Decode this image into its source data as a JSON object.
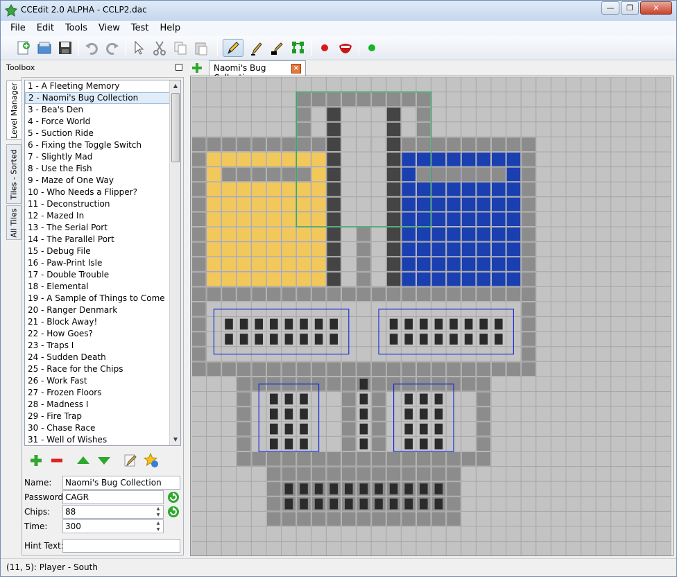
{
  "window": {
    "title": "CCEdit 2.0 ALPHA - CCLP2.dac",
    "controls": {
      "minimize": "—",
      "maximize": "❐",
      "close": "✕"
    }
  },
  "menu": [
    "File",
    "Edit",
    "Tools",
    "View",
    "Test",
    "Help"
  ],
  "toolbar": {
    "buttons": [
      "new-level-icon",
      "open-icon",
      "save-icon",
      "undo-icon",
      "redo-icon",
      "select-icon",
      "cut-icon",
      "copy-icon",
      "paste-icon",
      "draw-pencil-icon",
      "line-tool-icon",
      "fill-tool-icon",
      "path-tool-icon",
      "record-icon",
      "mouth-icon",
      "play-icon"
    ]
  },
  "toolbox": {
    "title": "Toolbox",
    "tabs": [
      "Level Manager",
      "Tiles - Sorted",
      "All Tiles"
    ],
    "levels": [
      "1 - A Fleeting Memory",
      "2 - Naomi's Bug Collection",
      "3 - Bea's Den",
      "4 - Force World",
      "5 - Suction Ride",
      "6 - Fixing the Toggle Switch",
      "7 - Slightly Mad",
      "8 - Use the Fish",
      "9 - Maze of One Way",
      "10 - Who Needs a Flipper?",
      "11 - Deconstruction",
      "12 - Mazed In",
      "13 - The Serial Port",
      "14 - The Parallel Port",
      "15 - Debug File",
      "16 - Paw-Print Isle",
      "17 - Double Trouble",
      "18 - Elemental",
      "19 - A Sample of Things to Come",
      "20 - Ranger Denmark",
      "21 - Block Away!",
      "22 - How Goes?",
      "23 - Traps I",
      "24 - Sudden Death",
      "25 - Race for the Chips",
      "26 - Work Fast",
      "27 - Frozen Floors",
      "28 - Madness I",
      "29 - Fire Trap",
      "30 - Chase Race",
      "31 - Well of Wishes"
    ],
    "selected_index": 1,
    "props": {
      "name_label": "Name:",
      "name_value": "Naomi's Bug Collection",
      "password_label": "Password:",
      "password_value": "CAGR",
      "chips_label": "Chips:",
      "chips_value": "88",
      "time_label": "Time:",
      "time_value": "300",
      "hint_label": "Hint Text:",
      "hint_value": ""
    }
  },
  "document": {
    "tab_label": "Naomi's Bug Collection"
  },
  "status": {
    "text": "(11, 5): Player - South"
  },
  "colors": {
    "wall": "#8c8c8c",
    "floor": "#c3c3c3",
    "gravel": "#444444",
    "water": "#1a3fb0",
    "fire": "#f3c85a",
    "chip": "#2b2b2b",
    "selection": "#2faa68",
    "wire": "#1b2fd6"
  }
}
